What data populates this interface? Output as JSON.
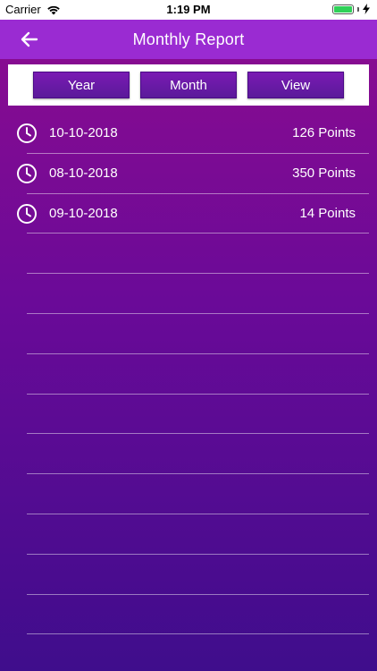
{
  "status_bar": {
    "carrier": "Carrier",
    "time": "1:19 PM",
    "battery_level": 1.0,
    "battery_color": "#2fd158"
  },
  "header": {
    "title": "Monthly Report",
    "back_icon": "arrow-left-icon",
    "color": "#9a2bd2"
  },
  "segments": {
    "year": "Year",
    "month": "Month",
    "view": "View"
  },
  "entries": [
    {
      "date": "10-10-2018",
      "points": "126 Points",
      "icon": "clock-icon"
    },
    {
      "date": "08-10-2018",
      "points": "350 Points",
      "icon": "clock-icon"
    },
    {
      "date": "09-10-2018",
      "points": "14 Points",
      "icon": "clock-icon"
    }
  ],
  "empty_rows": 10
}
